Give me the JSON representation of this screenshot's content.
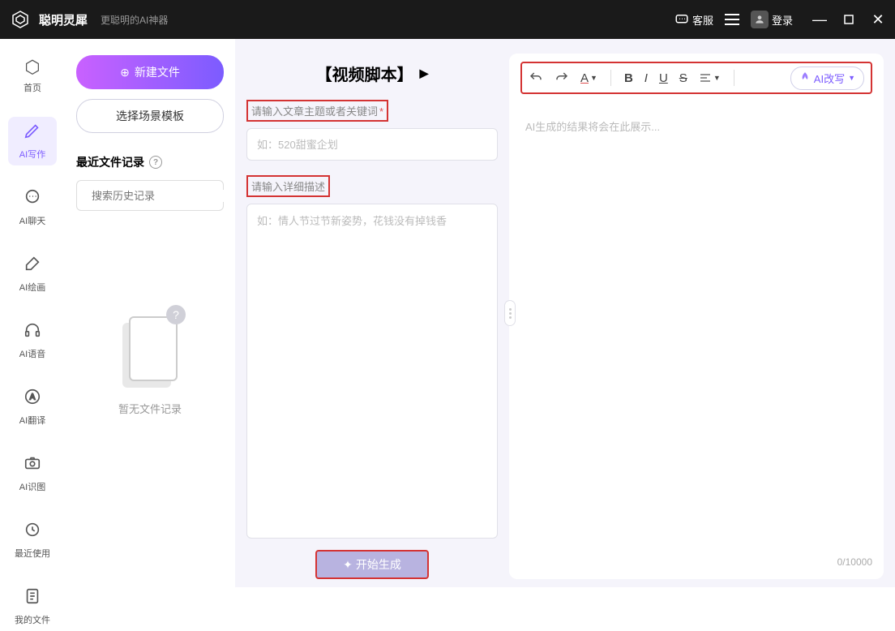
{
  "titlebar": {
    "app_name": "聪明灵犀",
    "tagline": "更聪明的AI神器",
    "support_label": "客服",
    "login_label": "登录"
  },
  "sidebar": {
    "items": [
      {
        "label": "首页",
        "icon": "⬡"
      },
      {
        "label": "AI写作",
        "icon": "✎"
      },
      {
        "label": "AI聊天",
        "icon": "💬"
      },
      {
        "label": "AI绘画",
        "icon": "🖌"
      },
      {
        "label": "AI语音",
        "icon": "🎧"
      },
      {
        "label": "AI翻译",
        "icon": "Ⓐ"
      },
      {
        "label": "AI识图",
        "icon": "📷"
      },
      {
        "label": "最近使用",
        "icon": "↻"
      },
      {
        "label": "我的文件",
        "icon": "📄"
      }
    ]
  },
  "file_panel": {
    "new_file_label": "新建文件",
    "template_label": "选择场景模板",
    "recent_header": "最近文件记录",
    "search_placeholder": "搜索历史记录",
    "empty_text": "暂无文件记录"
  },
  "input_section": {
    "title": "【视频脚本】",
    "topic_label": "请输入文章主题或者关键词",
    "topic_placeholder": "如：520甜蜜企划",
    "detail_label": "请输入详细描述",
    "detail_placeholder": "如：情人节过节新姿势，花钱没有掉钱香",
    "generate_label": "开始生成"
  },
  "output_section": {
    "placeholder": "AI生成的结果将会在此展示...",
    "rewrite_label": "AI改写",
    "char_count": "0/10000",
    "toolbar": {
      "font_label": "A",
      "bold": "B",
      "italic": "I",
      "underline": "U",
      "strike": "S"
    }
  }
}
